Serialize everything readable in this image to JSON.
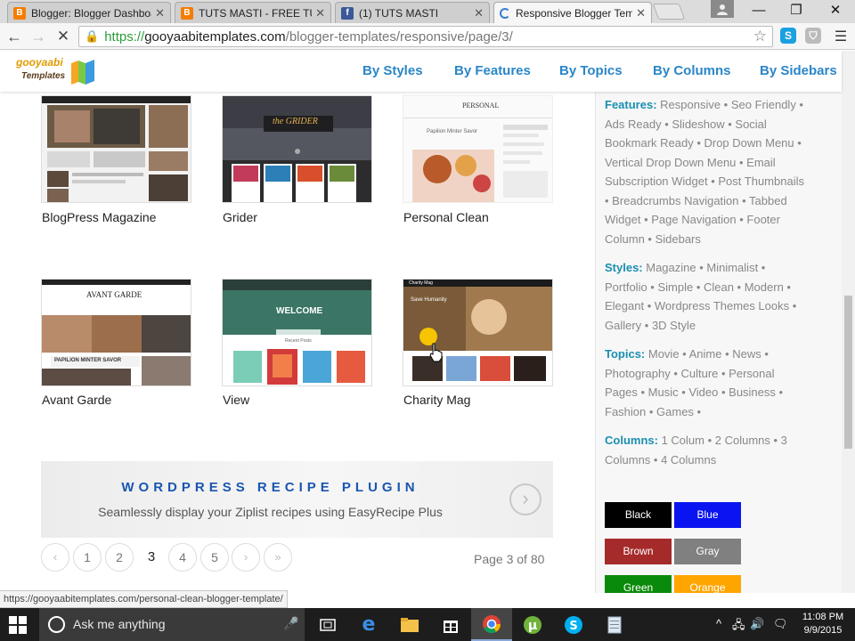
{
  "browser": {
    "tabs": [
      {
        "label": "Blogger: Blogger Dashboa",
        "icon": "blogger-icon",
        "active": false
      },
      {
        "label": "TUTS MASTI - FREE TUTOI",
        "icon": "blogger-icon",
        "active": false
      },
      {
        "label": "(1) TUTS MASTI",
        "icon": "facebook-icon",
        "active": false
      },
      {
        "label": "Responsive Blogger Temp",
        "icon": "loading-spinner-icon",
        "active": true
      }
    ],
    "address": {
      "scheme": "https://",
      "host": "gooyaabitemplates.com",
      "path": "/blogger-templates/responsive/page/3/"
    },
    "status_url": "https://gooyaabitemplates.com/personal-clean-blogger-template/"
  },
  "site": {
    "logo": {
      "line1": "gooyaabi",
      "line2": "Templates"
    },
    "nav": [
      "By Styles",
      "By Features",
      "By Topics",
      "By Columns",
      "By Sidebars"
    ]
  },
  "templates": [
    {
      "title": "BlogPress Magazine"
    },
    {
      "title": "Grider",
      "thumb_text": "the GRIDER"
    },
    {
      "title": "Personal Clean",
      "thumb_text": "PERSONAL",
      "thumb_sub": "Papilion Minter Savor"
    },
    {
      "title": "Avant Garde",
      "thumb_text": "AVANT GARDE",
      "thumb_sub": "PAPILION MINTER SAVOR"
    },
    {
      "title": "View",
      "thumb_text": "WELCOME",
      "thumb_sub": "Recent Posts"
    },
    {
      "title": "Charity Mag",
      "thumb_text": "Charity Mag",
      "thumb_sub": "Save Humanity"
    }
  ],
  "promo": {
    "title": "WORDPRESS RECIPE PLUGIN",
    "subtitle": "Seamlessly display your Ziplist recipes using EasyRecipe Plus"
  },
  "pagination": {
    "prev": "‹",
    "pages": [
      "1",
      "2",
      "3",
      "4",
      "5"
    ],
    "current": "3",
    "next": "›",
    "last": "»",
    "info": "Page 3 of 80"
  },
  "sidebar": {
    "filters": [
      {
        "head": "Features:",
        "text": " Responsive • Seo Friendly • Ads Ready • Slideshow • Social Bookmark Ready • Drop Down Menu • Vertical Drop Down Menu • Email Subscription Widget • Post Thumbnails • Breadcrumbs Navigation • Tabbed Widget • Page Navigation • Footer Column • Sidebars"
      },
      {
        "head": "Styles:",
        "text": " Magazine • Minimalist • Portfolio • Simple • Clean • Modern • Elegant • Wordpress Themes Looks • Gallery • 3D Style"
      },
      {
        "head": "Topics:",
        "text": " Movie • Anime • News • Photography • Culture • Personal Pages • Music • Video • Business • Fashion • Games •"
      },
      {
        "head": "Columns:",
        "text": " 1 Colum • 2 Columns • 3 Columns • 4 Columns"
      }
    ],
    "colors": [
      {
        "label": "Black",
        "color": "#000000"
      },
      {
        "label": "Blue",
        "color": "#0a14f0"
      },
      {
        "label": "Brown",
        "color": "#a52a2a"
      },
      {
        "label": "Gray",
        "color": "#808080"
      },
      {
        "label": "Green",
        "color": "#0a8a0a"
      },
      {
        "label": "Orange",
        "color": "#ffa500"
      }
    ]
  },
  "taskbar": {
    "search_placeholder": "Ask me anything",
    "time": "11:08 PM",
    "date": "9/9/2015"
  }
}
